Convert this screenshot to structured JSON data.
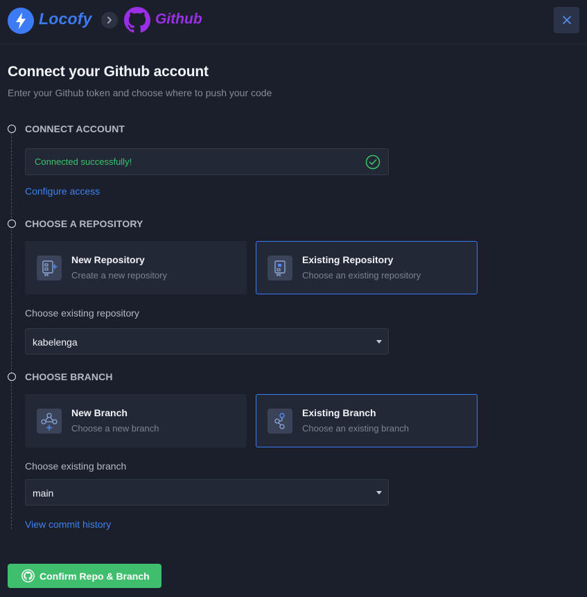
{
  "header": {
    "brand": "Locofy",
    "integration": "Github",
    "icons": {
      "brand_logo": "lightning-bolt-icon",
      "separator": "chevron-right-icon",
      "integration_logo": "github-icon",
      "close": "close-icon"
    }
  },
  "page": {
    "title": "Connect your Github account",
    "subtitle": "Enter your Github token and choose where to push your code"
  },
  "connect_account": {
    "heading": "CONNECT ACCOUNT",
    "status": "Connected successfully!",
    "status_icon": "check-circle-icon",
    "link": "Configure access"
  },
  "repository": {
    "heading": "CHOOSE A REPOSITORY",
    "options": [
      {
        "title": "New Repository",
        "description": "Create a new repository",
        "icon": "new-repository-icon",
        "selected": false
      },
      {
        "title": "Existing Repository",
        "description": "Choose an existing repository",
        "icon": "existing-repository-icon",
        "selected": true
      }
    ],
    "select_label": "Choose existing repository",
    "select_value": "kabelenga"
  },
  "branch": {
    "heading": "CHOOSE BRANCH",
    "options": [
      {
        "title": "New Branch",
        "description": "Choose a new branch",
        "icon": "new-branch-icon",
        "selected": false
      },
      {
        "title": "Existing Branch",
        "description": "Choose an existing branch",
        "icon": "existing-branch-icon",
        "selected": true
      }
    ],
    "select_label": "Choose existing branch",
    "select_value": "main",
    "link": "View commit history"
  },
  "footer": {
    "confirm_label": "Confirm Repo & Branch",
    "confirm_icon": "github-icon"
  },
  "colors": {
    "background": "#1b1f2b",
    "accent": "#3d7bf5",
    "github_purple": "#9b2fe6",
    "success": "#39c46a",
    "confirm_button": "#3fbf6e"
  }
}
